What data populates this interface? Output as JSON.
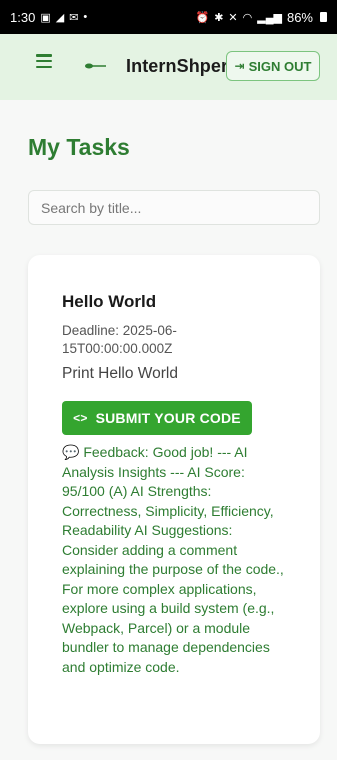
{
  "status_bar": {
    "time": "1:30",
    "left_icons": [
      "image-icon",
      "navigation-icon",
      "mail-icon",
      "dot-icon"
    ],
    "right_icons": [
      "alarm-icon",
      "bluetooth-icon",
      "mute-icon",
      "wifi-icon",
      "signal-icon"
    ],
    "battery": "86%"
  },
  "header": {
    "brand": "InternShpere",
    "sign_out_label": "SIGN OUT",
    "accent_color": "#2e7d32",
    "bg_color": "#e4f3e3"
  },
  "page": {
    "title": "My Tasks"
  },
  "search": {
    "placeholder": "Search by title..."
  },
  "tasks": [
    {
      "title": "Hello World",
      "deadline": "Deadline: 2025-06-15T00:00:00.000Z",
      "description": "Print Hello World",
      "submit_label": "SUBMIT YOUR CODE",
      "feedback": "Feedback: Good job! --- AI Analysis Insights --- AI Score: 95/100 (A) AI Strengths: Correctness, Simplicity, Efficiency, Readability AI Suggestions: Consider adding a comment explaining the purpose of the code., For more complex applications, explore using a build system (e.g., Webpack, Parcel) or a module bundler to manage dependencies and optimize code."
    }
  ]
}
